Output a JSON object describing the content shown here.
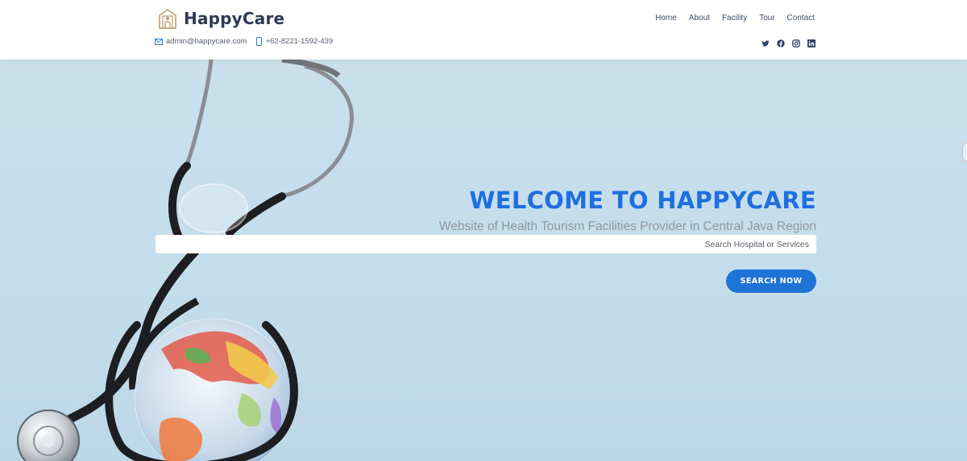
{
  "brand": {
    "name": "HappyCare"
  },
  "contact": {
    "email": "admin@happycare.com",
    "phone": "+62-8221-1592-439"
  },
  "nav": {
    "items": [
      "Home",
      "About",
      "Facility",
      "Tour",
      "Contact"
    ]
  },
  "social": {
    "icons": [
      "twitter-icon",
      "facebook-icon",
      "instagram-icon",
      "linkedin-icon"
    ]
  },
  "hero": {
    "title": "WELCOME TO HAPPYCARE",
    "subtitle": "Website of Health Tourism Facilities Provider in Central Java Region",
    "search_placeholder": "Search Hospital or Services",
    "search_button": "SEARCH NOW"
  },
  "colors": {
    "accent": "#1e6fe0",
    "button": "#1e74d6",
    "hero_bg": "#c6deeb",
    "brand_text": "#2b3a55"
  }
}
